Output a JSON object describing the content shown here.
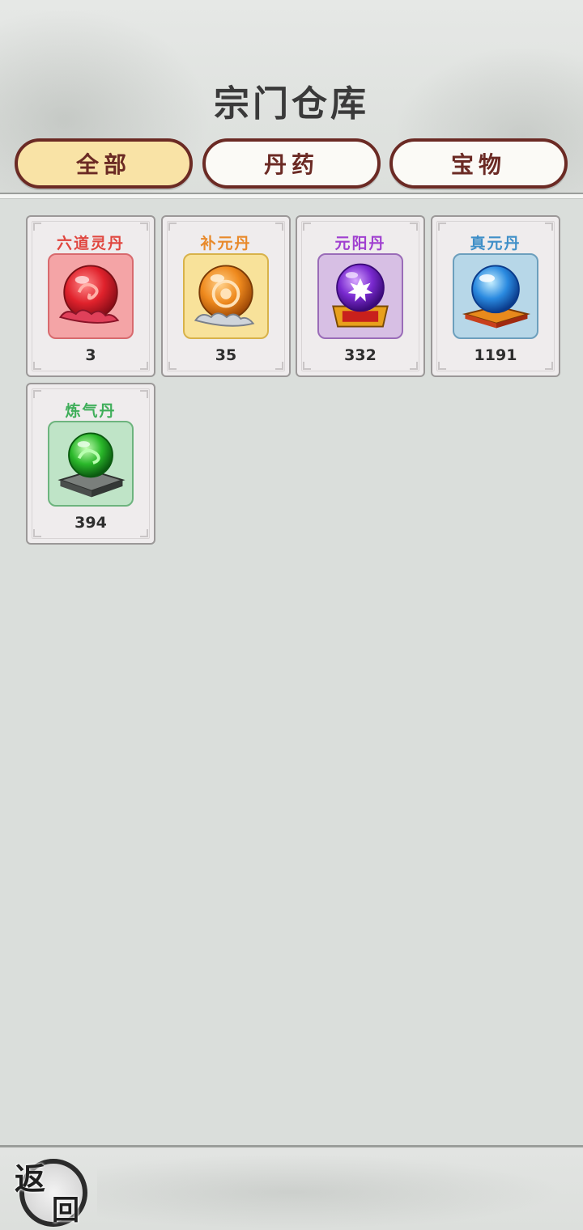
{
  "title": "宗门仓库",
  "tabs": [
    {
      "label": "全部",
      "active": true
    },
    {
      "label": "丹药",
      "active": false
    },
    {
      "label": "宝物",
      "active": false
    }
  ],
  "items": [
    {
      "name": "六道灵丹",
      "count": "3",
      "name_color": "#e0463f",
      "box_bg": "#f4a4a6",
      "box_border": "#d86a6e",
      "icon": "red-pill-icon"
    },
    {
      "name": "补元丹",
      "count": "35",
      "name_color": "#e8892a",
      "box_bg": "#f8e29a",
      "box_border": "#d8b24a",
      "icon": "orange-pill-icon"
    },
    {
      "name": "元阳丹",
      "count": "332",
      "name_color": "#a040d0",
      "box_bg": "#d7bfe4",
      "box_border": "#9a6cb8",
      "icon": "purple-pill-icon"
    },
    {
      "name": "真元丹",
      "count": "1191",
      "name_color": "#3f8fc8",
      "box_bg": "#b7d7e8",
      "box_border": "#6c9fbd",
      "icon": "blue-pill-icon"
    },
    {
      "name": "炼气丹",
      "count": "394",
      "name_color": "#3fae5a",
      "box_bg": "#bfe4c7",
      "box_border": "#6db47e",
      "icon": "green-pill-icon"
    }
  ],
  "back": {
    "char1": "返",
    "char2": "回"
  }
}
